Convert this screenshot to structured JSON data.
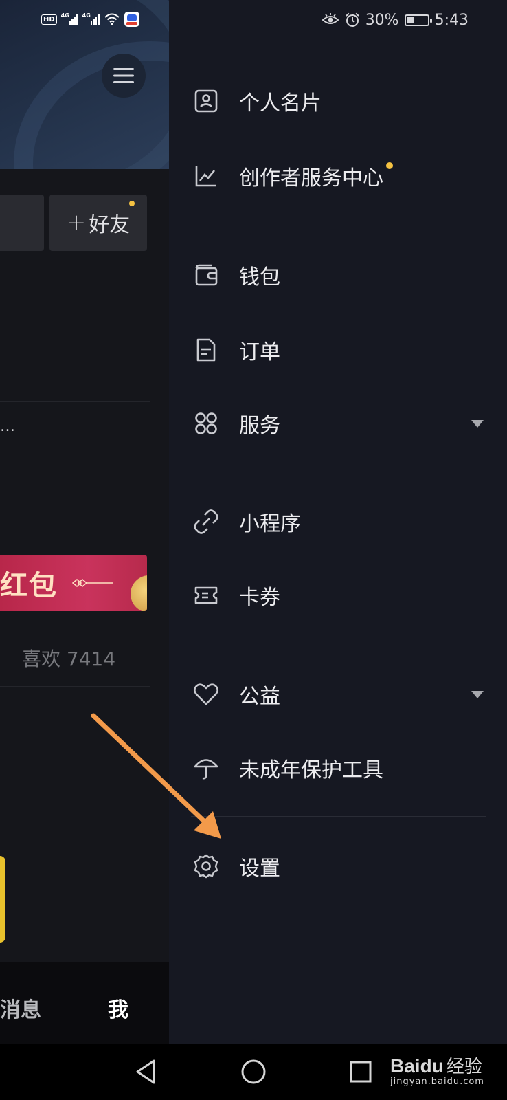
{
  "status_bar": {
    "left_hd": "HD",
    "signal_label_1": "4G",
    "signal_label_2": "4G",
    "battery_percent": "30%",
    "time": "5:43"
  },
  "background_page": {
    "add_friend_label": "好友",
    "truncated_text": "…",
    "red_packet_text": "红包",
    "likes_text": "喜欢 7414",
    "nav_messages": "消息",
    "nav_me": "我"
  },
  "drawer": {
    "items": [
      {
        "label": "个人名片",
        "icon": "profile-card-icon"
      },
      {
        "label": "创作者服务中心",
        "icon": "creator-chart-icon",
        "badge_dot": true
      },
      {
        "label": "钱包",
        "icon": "wallet-icon"
      },
      {
        "label": "订单",
        "icon": "order-document-icon"
      },
      {
        "label": "服务",
        "icon": "services-grid-icon",
        "expandable": true
      },
      {
        "label": "小程序",
        "icon": "mini-program-link-icon"
      },
      {
        "label": "卡券",
        "icon": "coupon-ticket-icon"
      },
      {
        "label": "公益",
        "icon": "charity-heart-icon",
        "expandable": true
      },
      {
        "label": "未成年保护工具",
        "icon": "umbrella-icon"
      },
      {
        "label": "设置",
        "icon": "settings-gear-icon"
      }
    ]
  },
  "annotation": {
    "arrow_color": "#f39a4a",
    "points_to": "设置"
  },
  "watermark": {
    "logo": "Bai",
    "logo_paw": "du",
    "cn": "经验",
    "url": "jingyan.baidu.com"
  },
  "colors": {
    "accent_dot": "#f5c242",
    "drawer_bg": "#161822",
    "red_packet": "#c9335c"
  }
}
